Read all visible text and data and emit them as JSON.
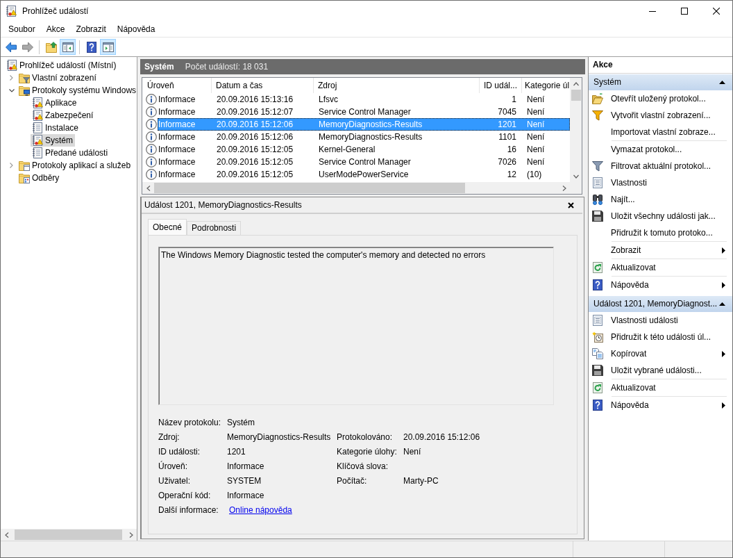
{
  "window": {
    "title": "Prohlížeč událostí"
  },
  "menu": [
    "Soubor",
    "Akce",
    "Zobrazit",
    "Nápověda"
  ],
  "toolbar": [
    [
      {
        "kind": "back",
        "pressed": false,
        "disabled": false
      },
      {
        "kind": "forward",
        "pressed": false,
        "disabled": true
      }
    ],
    [
      {
        "kind": "up",
        "pressed": false,
        "disabled": false
      },
      {
        "kind": "consoletree",
        "pressed": true,
        "disabled": false
      }
    ],
    [
      {
        "kind": "help",
        "pressed": false,
        "disabled": false
      },
      {
        "kind": "actionpane",
        "pressed": true,
        "disabled": false
      }
    ]
  ],
  "tree": [
    {
      "label": "Prohlížeč událostí (Místní)",
      "kind": "viewer",
      "selected": false,
      "children": [
        {
          "label": "Vlastní zobrazení",
          "kind": "viewfolder",
          "selected": false,
          "expanded": false
        },
        {
          "label": "Protokoly systému Windows",
          "kind": "logfolder",
          "selected": false,
          "expanded": true,
          "children": [
            {
              "label": "Aplikace",
              "kind": "log",
              "selected": false
            },
            {
              "label": "Zabezpečení",
              "kind": "log",
              "selected": false
            },
            {
              "label": "Instalace",
              "kind": "plainlog",
              "selected": false
            },
            {
              "label": "Systém",
              "kind": "log",
              "selected": true
            },
            {
              "label": "Předané události",
              "kind": "plainlog",
              "selected": false
            }
          ]
        },
        {
          "label": "Protokoly aplikací a služeb",
          "kind": "appfolder",
          "selected": false,
          "expanded": false
        },
        {
          "label": "Odběry",
          "kind": "subscriptions",
          "selected": false
        }
      ]
    }
  ],
  "log_header": {
    "title": "Systém",
    "count": "Počet událostí: 18 031"
  },
  "events": {
    "columns": [
      "Úroveň",
      "Datum a čas",
      "Zdroj",
      "ID udál...",
      "Kategorie úl"
    ],
    "rows": [
      {
        "selected": false,
        "cells": [
          "Informace",
          "20.09.2016 15:13:16",
          "Lfsvc",
          "1",
          "Není"
        ]
      },
      {
        "selected": false,
        "cells": [
          "Informace",
          "20.09.2016 15:12:07",
          "Service Control Manager",
          "7045",
          "Není"
        ]
      },
      {
        "selected": true,
        "cells": [
          "Informace",
          "20.09.2016 15:12:06",
          "MemoryDiagnostics-Results",
          "1201",
          "Není"
        ]
      },
      {
        "selected": false,
        "cells": [
          "Informace",
          "20.09.2016 15:12:06",
          "MemoryDiagnostics-Results",
          "1101",
          "Není"
        ]
      },
      {
        "selected": false,
        "cells": [
          "Informace",
          "20.09.2016 15:12:05",
          "Kernel-General",
          "16",
          "Není"
        ]
      },
      {
        "selected": false,
        "cells": [
          "Informace",
          "20.09.2016 15:12:05",
          "Service Control Manager",
          "7026",
          "Není"
        ]
      },
      {
        "selected": false,
        "cells": [
          "Informace",
          "20.09.2016 15:12:05",
          "UserModePowerService",
          "12",
          "(10)"
        ]
      }
    ]
  },
  "event_detail": {
    "title": "Událost 1201, MemoryDiagnostics-Results",
    "tabs": [
      {
        "label": "Obecné",
        "selected": true
      },
      {
        "label": "Podrobnosti",
        "selected": false
      }
    ],
    "description": "The Windows Memory Diagnostic tested the computer's memory and detected no errors",
    "fields": [
      [
        {
          "label": "Název protokolu:",
          "value": "Systém"
        }
      ],
      [
        {
          "label": "Zdroj:",
          "value": "MemoryDiagnostics-Results"
        },
        {
          "label": "Protokolováno:",
          "value": "20.09.2016 15:12:06"
        }
      ],
      [
        {
          "label": "ID události:",
          "value": "1201"
        },
        {
          "label": "Kategorie úlohy:",
          "value": "Není"
        }
      ],
      [
        {
          "label": "Úroveň:",
          "value": "Informace"
        },
        {
          "label": "Klíčová slova:"
        }
      ],
      [
        {
          "label": "Uživatel:",
          "value": "SYSTEM"
        },
        {
          "label": "Počítač:",
          "value": "Marty-PC"
        }
      ],
      [
        {
          "label": "Operační kód:",
          "value": "Informace"
        }
      ],
      [
        {
          "label": "Další informace:",
          "link": "Online nápověda"
        }
      ]
    ]
  },
  "actions": {
    "title": "Akce",
    "sections": [
      {
        "title": "Systém",
        "expanded": true,
        "groups": [
          [
            {
              "label": "Otevřít uložený protokol...",
              "kind": "open",
              "submenu": false
            },
            {
              "label": "Vytvořit vlastní zobrazení...",
              "kind": "newview",
              "submenu": false
            },
            {
              "label": "Importovat vlastní zobraze...",
              "kind": "importview",
              "submenu": false
            }
          ],
          [
            {
              "label": "Vymazat protokol...",
              "kind": "clearlog",
              "submenu": false
            },
            {
              "label": "Filtrovat aktuální protokol...",
              "kind": "filter",
              "submenu": false
            },
            {
              "label": "Vlastnosti",
              "kind": "properties",
              "submenu": false
            },
            {
              "label": "Najít...",
              "kind": "find",
              "submenu": false
            },
            {
              "label": "Uložit všechny události jak...",
              "kind": "saveall",
              "submenu": false
            },
            {
              "label": "Přidružit k tomuto protoko...",
              "kind": "attachlog",
              "submenu": false
            }
          ],
          [
            {
              "label": "Zobrazit",
              "kind": "view",
              "submenu": true
            }
          ],
          [
            {
              "label": "Aktualizovat",
              "kind": "refresh",
              "submenu": false
            }
          ],
          [
            {
              "label": "Nápověda",
              "kind": "help",
              "submenu": true
            }
          ]
        ]
      },
      {
        "title": "Událost 1201, MemoryDiagnost...",
        "expanded": true,
        "groups": [
          [
            {
              "label": "Vlastnosti události",
              "kind": "eventproperties",
              "submenu": false
            },
            {
              "label": "Přidružit k této události úl...",
              "kind": "attachevent",
              "submenu": false
            },
            {
              "label": "Kopírovat",
              "kind": "copy",
              "submenu": true
            },
            {
              "label": "Uložit vybrané události...",
              "kind": "saveselected",
              "submenu": false
            }
          ],
          [
            {
              "label": "Aktualizovat",
              "kind": "refresh",
              "submenu": false
            }
          ],
          [
            {
              "label": "Nápověda",
              "kind": "help",
              "submenu": true
            }
          ]
        ]
      }
    ]
  }
}
